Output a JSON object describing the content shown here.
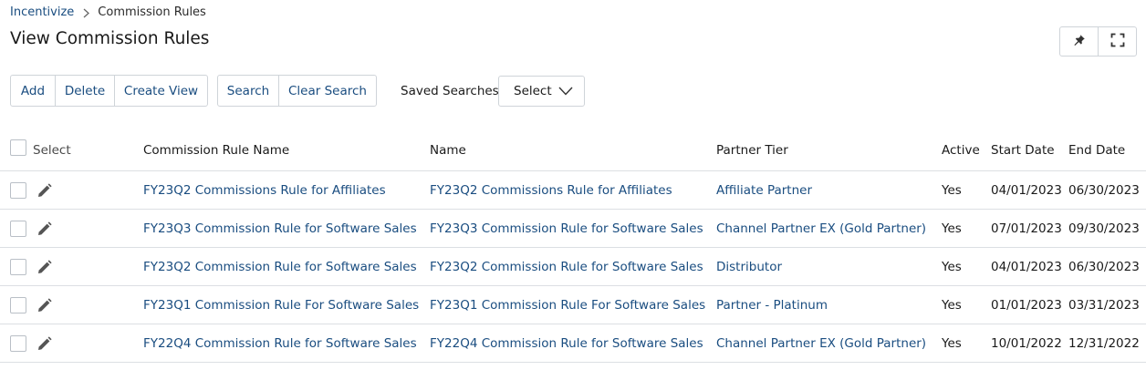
{
  "breadcrumb": {
    "root": "Incentivize",
    "current": "Commission Rules"
  },
  "page": {
    "title": "View Commission Rules"
  },
  "header_tools": [
    {
      "name": "pin-icon"
    },
    {
      "name": "fullscreen-icon"
    }
  ],
  "toolbar": {
    "add": "Add",
    "delete": "Delete",
    "create_view": "Create View",
    "search": "Search",
    "clear_search": "Clear Search",
    "saved_searches_label": "Saved Searches",
    "saved_searches_value": "Select"
  },
  "table": {
    "columns": {
      "select": "Select",
      "rule_name": "Commission Rule Name",
      "name": "Name",
      "partner_tier": "Partner Tier",
      "active": "Active",
      "start_date": "Start Date",
      "end_date": "End Date"
    },
    "rows": [
      {
        "rule_name": "FY23Q2 Commissions Rule for Affiliates",
        "name": "FY23Q2 Commissions Rule for Affiliates",
        "partner_tier": "Affiliate Partner",
        "active": "Yes",
        "start_date": "04/01/2023",
        "end_date": "06/30/2023"
      },
      {
        "rule_name": "FY23Q3 Commission Rule for Software Sales",
        "name": "FY23Q3 Commission Rule for Software Sales",
        "partner_tier": "Channel Partner EX (Gold Partner)",
        "active": "Yes",
        "start_date": "07/01/2023",
        "end_date": "09/30/2023"
      },
      {
        "rule_name": "FY23Q2 Commission Rule for Software Sales",
        "name": "FY23Q2 Commission Rule for Software Sales",
        "partner_tier": "Distributor",
        "active": "Yes",
        "start_date": "04/01/2023",
        "end_date": "06/30/2023"
      },
      {
        "rule_name": "FY23Q1 Commission Rule For Software Sales",
        "name": "FY23Q1 Commission Rule For Software Sales",
        "partner_tier": "Partner - Platinum",
        "active": "Yes",
        "start_date": "01/01/2023",
        "end_date": "03/31/2023"
      },
      {
        "rule_name": "FY22Q4 Commission Rule for Software Sales",
        "name": "FY22Q4 Commission Rule for Software Sales",
        "partner_tier": "Channel Partner EX (Gold Partner)",
        "active": "Yes",
        "start_date": "10/01/2022",
        "end_date": "12/31/2022"
      }
    ]
  }
}
